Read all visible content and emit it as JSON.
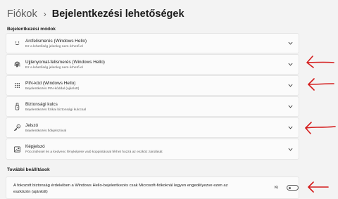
{
  "breadcrumb": {
    "parent": "Fiókok",
    "separator": "›",
    "current": "Bejelentkezési lehetőségek"
  },
  "signin_section": {
    "title": "Bejelentkezési módok",
    "items": [
      {
        "icon": "face-recognition-icon",
        "title": "Arcfelismerés (Windows Hello)",
        "subtitle": "Ez a lehetőség jelenleg nem érhető el"
      },
      {
        "icon": "fingerprint-icon",
        "title": "Ujjlenyomat-felismerés (Windows Hello)",
        "subtitle": "Ez a lehetőség jelenleg nem érhető el"
      },
      {
        "icon": "pin-keypad-icon",
        "title": "PIN-kód (Windows Hello)",
        "subtitle": "Bejelentkezés PIN-kóddal (ajánlott)"
      },
      {
        "icon": "security-key-icon",
        "title": "Biztonsági kulcs",
        "subtitle": "Bejelentkezés fizikai biztonsági kulccsal"
      },
      {
        "icon": "key-icon",
        "title": "Jelszó",
        "subtitle": "Bejelentkezés fiókjelszóval"
      },
      {
        "icon": "picture-password-icon",
        "title": "Képjelszó",
        "subtitle": "Pöccintéssel és a kedvenc fényképére való koppintással férhet hozzá az eszköz zárolását"
      }
    ]
  },
  "additional_section": {
    "title": "További beállítások",
    "setting_text": "A fokozott biztonság érdekében a Windows Hello-bejelentkezés csak Microsoft-fiókoknál legyen engedélyezve ezen az eszközön (ajánlott)",
    "toggle_state_label": "Ki",
    "toggle_on": false
  },
  "colors": {
    "background": "#f3f3f3",
    "card": "#fbfbfb",
    "annotation_red": "#d41c1c"
  }
}
